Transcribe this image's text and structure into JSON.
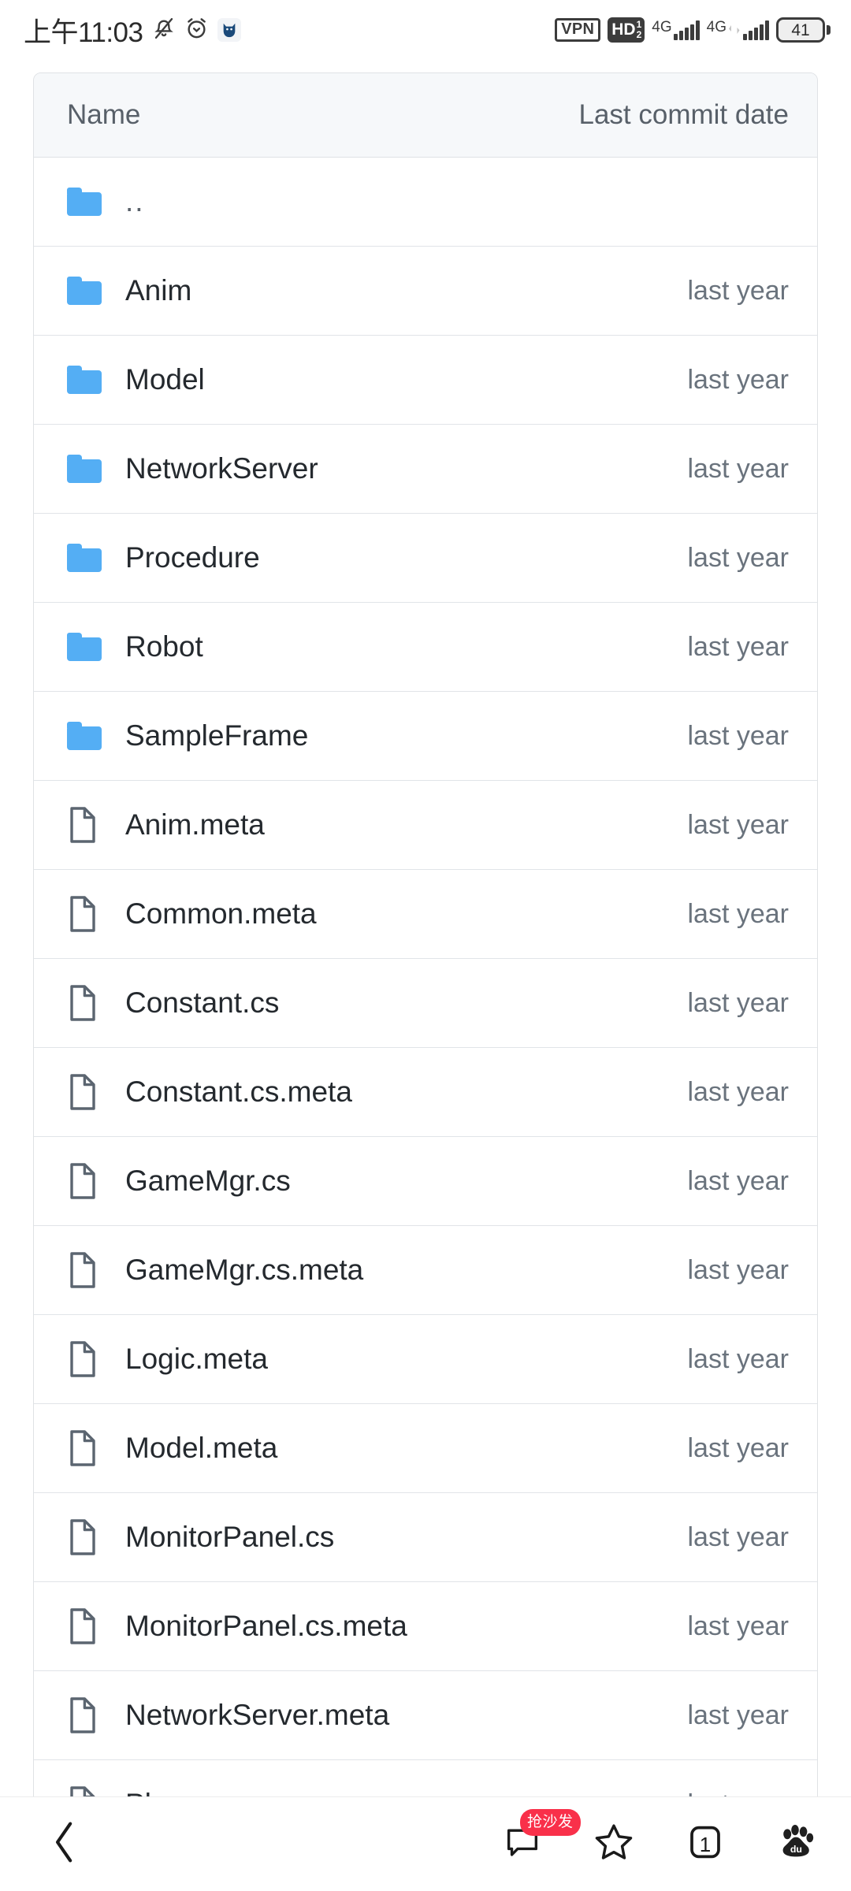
{
  "status_bar": {
    "time": "上午11:03",
    "icons_left": [
      "mute-icon",
      "alarm-icon",
      "cat-app-icon"
    ],
    "vpn_label": "VPN",
    "hd_label": "HD",
    "hd_sub_top": "1",
    "hd_sub_bottom": "2",
    "sim1_network": "4G",
    "sim2_network": "4G",
    "battery_level": "41"
  },
  "file_list": {
    "header": {
      "name_column": "Name",
      "date_column": "Last commit date"
    },
    "rows": [
      {
        "name": "..",
        "type": "folder",
        "date": ""
      },
      {
        "name": "Anim",
        "type": "folder",
        "date": "last year"
      },
      {
        "name": "Model",
        "type": "folder",
        "date": "last year"
      },
      {
        "name": "NetworkServer",
        "type": "folder",
        "date": "last year"
      },
      {
        "name": "Procedure",
        "type": "folder",
        "date": "last year"
      },
      {
        "name": "Robot",
        "type": "folder",
        "date": "last year"
      },
      {
        "name": "SampleFrame",
        "type": "folder",
        "date": "last year"
      },
      {
        "name": "Anim.meta",
        "type": "file",
        "date": "last year"
      },
      {
        "name": "Common.meta",
        "type": "file",
        "date": "last year"
      },
      {
        "name": "Constant.cs",
        "type": "file",
        "date": "last year"
      },
      {
        "name": "Constant.cs.meta",
        "type": "file",
        "date": "last year"
      },
      {
        "name": "GameMgr.cs",
        "type": "file",
        "date": "last year"
      },
      {
        "name": "GameMgr.cs.meta",
        "type": "file",
        "date": "last year"
      },
      {
        "name": "Logic.meta",
        "type": "file",
        "date": "last year"
      },
      {
        "name": "Model.meta",
        "type": "file",
        "date": "last year"
      },
      {
        "name": "MonitorPanel.cs",
        "type": "file",
        "date": "last year"
      },
      {
        "name": "MonitorPanel.cs.meta",
        "type": "file",
        "date": "last year"
      },
      {
        "name": "NetworkServer.meta",
        "type": "file",
        "date": "last year"
      },
      {
        "name": "Phone.cs",
        "type": "file",
        "date": "last year"
      }
    ]
  },
  "bottom_nav": {
    "back_icon": "chevron-left-icon",
    "comment_icon": "comment-bubble-icon",
    "comment_badge": "抢沙发",
    "favorite_icon": "star-icon",
    "tabs_icon": "tab-count-icon",
    "tabs_count": "1",
    "home_icon": "baidu-paw-icon"
  },
  "colors": {
    "folder_blue": "#54aef4",
    "file_gray": "#5b6570",
    "badge_red": "#f9304a",
    "header_bg": "#f6f8fa",
    "border": "#e1e4e8",
    "text_primary": "#24292e",
    "text_muted": "#6a737d"
  }
}
